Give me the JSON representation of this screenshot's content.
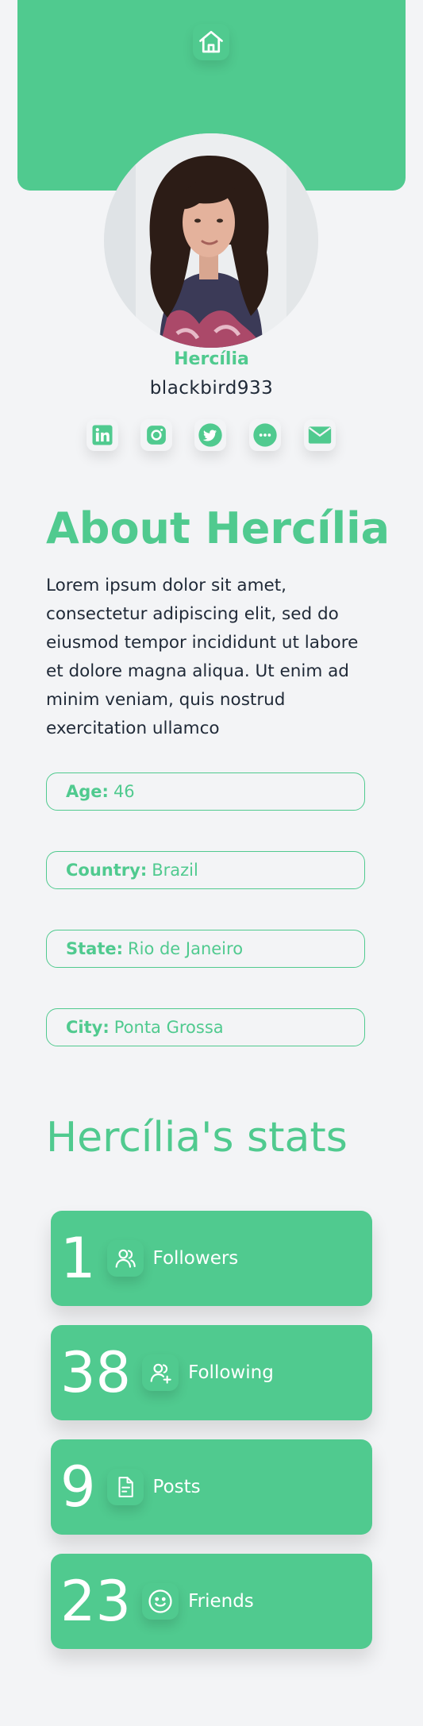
{
  "nav": {
    "home_icon": "home-icon"
  },
  "profile": {
    "name": "Hercília",
    "username": "blackbird933",
    "avatar": "profile-photo"
  },
  "socials": [
    {
      "icon": "linkedin-icon"
    },
    {
      "icon": "instagram-icon"
    },
    {
      "icon": "twitter-icon"
    },
    {
      "icon": "chat-bubble-icon"
    },
    {
      "icon": "mail-icon"
    }
  ],
  "about": {
    "title": "About Hercília",
    "bio": "Lorem ipsum dolor sit amet, consectetur adipiscing elit, sed do eiusmod tempor incididunt ut labore et dolore magna aliqua. Ut enim ad minim veniam, quis nostrud exercitation ullamco",
    "fields": [
      {
        "label": "Age:",
        "value": "46"
      },
      {
        "label": "Country:",
        "value": "Brazil"
      },
      {
        "label": "State:",
        "value": "Rio de Janeiro"
      },
      {
        "label": "City:",
        "value": "Ponta Grossa"
      }
    ]
  },
  "stats": {
    "title": "Hercília's stats",
    "items": [
      {
        "value": "1",
        "label": "Followers",
        "icon": "users-icon"
      },
      {
        "value": "38",
        "label": "Following",
        "icon": "user-plus-icon"
      },
      {
        "value": "9",
        "label": "Posts",
        "icon": "document-icon"
      },
      {
        "value": "23",
        "label": "Friends",
        "icon": "smile-icon"
      }
    ]
  },
  "colors": {
    "accent": "#50ca8f",
    "background": "#f3f4f6",
    "text": "#1f2937"
  }
}
